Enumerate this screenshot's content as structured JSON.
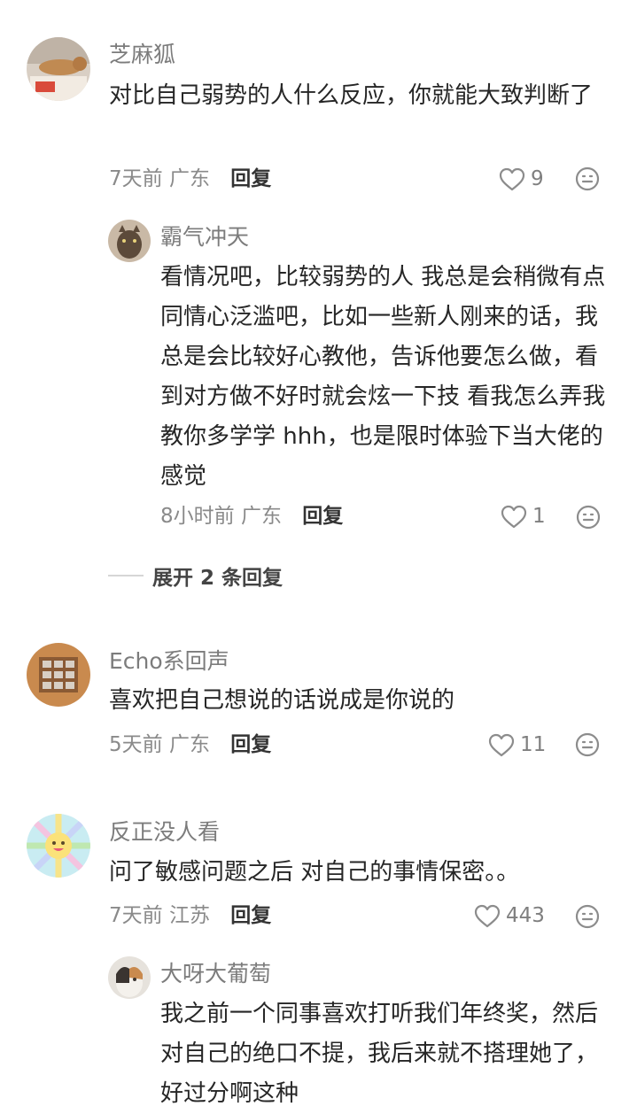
{
  "comments": [
    {
      "user": "芝麻狐",
      "text": "对比自己弱势的人什么反应，你就能大致判断了",
      "time": "7天前",
      "location": "广东",
      "reply_label": "回复",
      "likes": "9",
      "replies": [
        {
          "user": "霸气冲天",
          "text": "看情况吧，比较弱势的人 我总是会稍微有点同情心泛滥吧，比如一些新人刚来的话，我总是会比较好心教他，告诉他要怎么做，看到对方做不好时就会炫一下技 看我怎么弄我教你多学学 hhh，也是限时体验下当大佬的感觉",
          "time": "8小时前",
          "location": "广东",
          "reply_label": "回复",
          "likes": "1"
        }
      ],
      "expand_label": "展开 2 条回复"
    },
    {
      "user": "Echo系回声",
      "text": "喜欢把自己想说的话说成是你说的",
      "time": "5天前",
      "location": "广东",
      "reply_label": "回复",
      "likes": "11"
    },
    {
      "user": "反正没人看",
      "text": "问了敏感问题之后 对自己的事情保密。。",
      "time": "7天前",
      "location": "江苏",
      "reply_label": "回复",
      "likes": "443",
      "replies": [
        {
          "user": "大呀大葡萄",
          "text": "我之前一个同事喜欢打听我们年终奖，然后对自己的绝口不提，我后来就不搭理她了，好过分啊这种"
        }
      ]
    }
  ],
  "icons": {
    "like": "heart-outline-icon",
    "emoji": "neutral-face-icon"
  },
  "colors": {
    "name": "#7c7c7c",
    "meta": "#8a8a8a",
    "text": "#262626"
  }
}
